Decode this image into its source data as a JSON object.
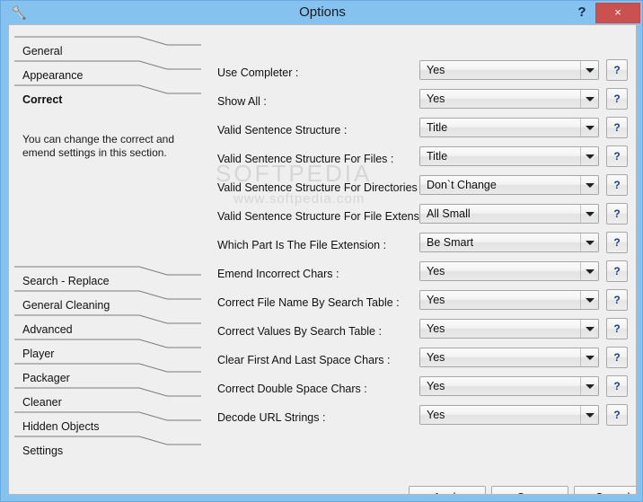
{
  "window": {
    "title": "Options",
    "icon": "wrench-icon",
    "help_label": "?",
    "close_label": "×",
    "accent_color": "#85c2f0",
    "close_color": "#cb5050",
    "client_bg": "#efefef"
  },
  "sidebar": {
    "items": [
      {
        "label": "General",
        "selected": false
      },
      {
        "label": "Appearance",
        "selected": false
      },
      {
        "label": "Correct",
        "selected": true
      },
      {
        "label": "Search - Replace",
        "selected": false
      },
      {
        "label": "General Cleaning",
        "selected": false
      },
      {
        "label": "Advanced",
        "selected": false
      },
      {
        "label": "Player",
        "selected": false
      },
      {
        "label": "Packager",
        "selected": false
      },
      {
        "label": "Cleaner",
        "selected": false
      },
      {
        "label": "Hidden Objects",
        "selected": false
      },
      {
        "label": "Settings",
        "selected": false
      }
    ],
    "description": "You can change the correct and emend settings in this section."
  },
  "form": {
    "help_button_label": "?",
    "rows": [
      {
        "label": "Use Completer :",
        "value": "Yes"
      },
      {
        "label": "Show All :",
        "value": "Yes"
      },
      {
        "label": "Valid Sentence Structure :",
        "value": "Title"
      },
      {
        "label": "Valid Sentence Structure For Files :",
        "value": "Title"
      },
      {
        "label": "Valid Sentence Structure For Directories :",
        "value": "Don`t Change"
      },
      {
        "label": "Valid Sentence Structure For File Extensions :",
        "value": "All Small"
      },
      {
        "label": "Which Part Is The File Extension :",
        "value": "Be Smart"
      },
      {
        "label": "Emend Incorrect Chars :",
        "value": "Yes"
      },
      {
        "label": "Correct File Name By Search Table :",
        "value": "Yes"
      },
      {
        "label": "Correct Values By Search Table :",
        "value": "Yes"
      },
      {
        "label": "Clear First And Last Space Chars :",
        "value": "Yes"
      },
      {
        "label": "Correct Double Space Chars :",
        "value": "Yes"
      },
      {
        "label": "Decode URL Strings :",
        "value": "Yes"
      }
    ]
  },
  "buttons": {
    "apply": "Apply",
    "save": "Save",
    "cancel": "Cancel"
  },
  "watermark": {
    "line1": "SOFTPEDIA",
    "line2": "www.softpedia.com"
  }
}
